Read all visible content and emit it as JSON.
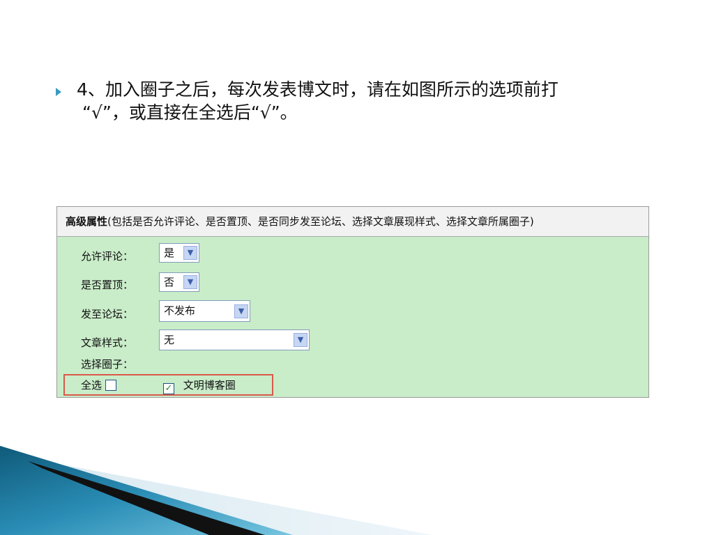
{
  "instruction": {
    "line1": "4、加入圈子之后，每次发表博文时，请在如图所示的选项前打",
    "line2": "“√”，或直接在全选后“√”。"
  },
  "panel": {
    "header_bold": "高级属性",
    "header_rest": "(包括是否允许评论、是否置顶、是否同步发至论坛、选择文章展现样式、选择文章所属圈子)",
    "fields": [
      {
        "label": "允许评论：",
        "value": "是"
      },
      {
        "label": "是否置顶：",
        "value": "否"
      },
      {
        "label": "发至论坛：",
        "value": "不发布"
      },
      {
        "label": "文章样式：",
        "value": "无"
      }
    ],
    "circle_label": "选择圈子：",
    "select_all_label": "全选",
    "select_all_checked": false,
    "circle_name": "文明博客圈",
    "circle_checked": true,
    "dropdown_icon": "chevron-down-icon",
    "check_icon": "check-icon"
  },
  "colors": {
    "panel_bg": "#c9ecc9",
    "header_bg": "#f2f2f2",
    "highlight_border": "#d9584a",
    "bullet": "#3a9bc1"
  }
}
